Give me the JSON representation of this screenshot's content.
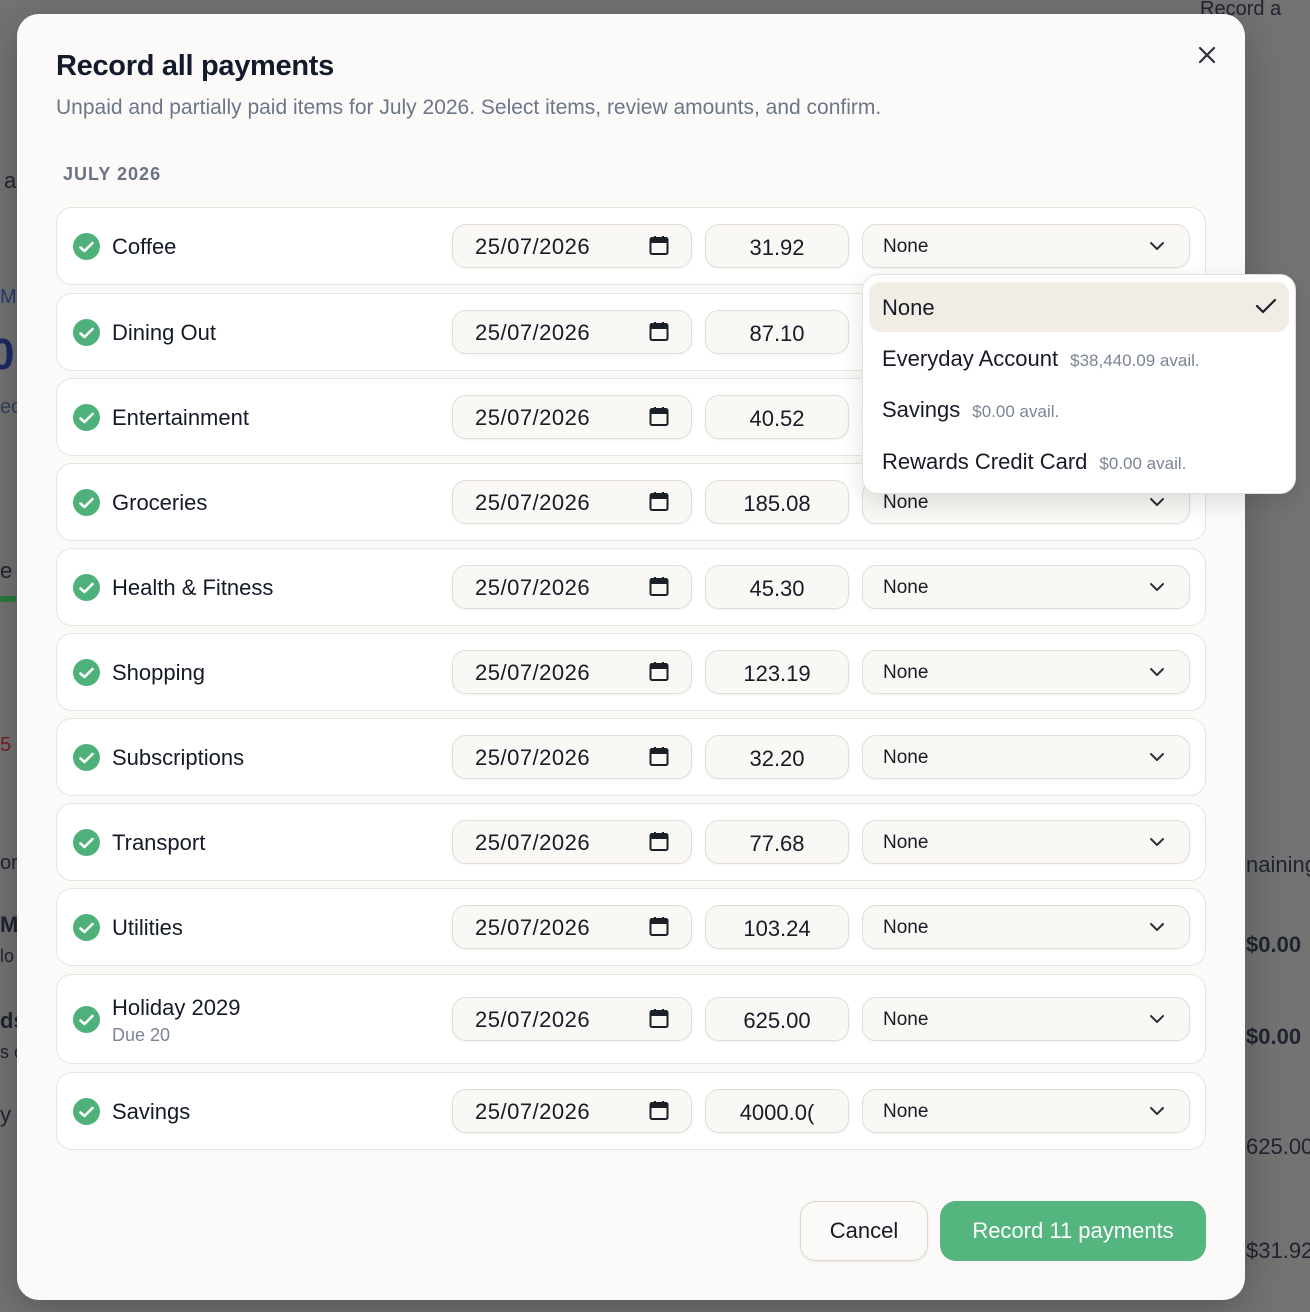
{
  "background": {
    "fragments": [
      "Record a",
      "a",
      "Mc",
      "0",
      "ec",
      "e",
      "5",
      "or",
      "M",
      "lo",
      "ds",
      "s c",
      "y",
      "naining",
      "$0.00",
      "$0.00",
      "625.00",
      "$31.92"
    ]
  },
  "modal": {
    "title": "Record all payments",
    "subtitle": "Unpaid and partially paid items for July 2026. Select items, review amounts, and confirm.",
    "close_icon": "close-icon",
    "section_label": "JULY 2026",
    "rows": [
      {
        "name": "Coffee",
        "sub": "",
        "date": "25/07/2026",
        "amount": "31.92",
        "account": "None"
      },
      {
        "name": "Dining Out",
        "sub": "",
        "date": "25/07/2026",
        "amount": "87.10",
        "account": "None"
      },
      {
        "name": "Entertainment",
        "sub": "",
        "date": "25/07/2026",
        "amount": "40.52",
        "account": "None"
      },
      {
        "name": "Groceries",
        "sub": "",
        "date": "25/07/2026",
        "amount": "185.08",
        "account": "None"
      },
      {
        "name": "Health & Fitness",
        "sub": "",
        "date": "25/07/2026",
        "amount": "45.30",
        "account": "None"
      },
      {
        "name": "Shopping",
        "sub": "",
        "date": "25/07/2026",
        "amount": "123.19",
        "account": "None"
      },
      {
        "name": "Subscriptions",
        "sub": "",
        "date": "25/07/2026",
        "amount": "32.20",
        "account": "None"
      },
      {
        "name": "Transport",
        "sub": "",
        "date": "25/07/2026",
        "amount": "77.68",
        "account": "None"
      },
      {
        "name": "Utilities",
        "sub": "",
        "date": "25/07/2026",
        "amount": "103.24",
        "account": "None"
      },
      {
        "name": "Holiday 2029",
        "sub": "Due 20",
        "date": "25/07/2026",
        "amount": "625.00",
        "account": "None"
      },
      {
        "name": "Savings",
        "sub": "",
        "date": "25/07/2026",
        "amount": "4000.0(",
        "account": "None"
      }
    ],
    "dropdown": {
      "options": [
        {
          "label": "None",
          "avail": "",
          "selected": true
        },
        {
          "label": "Everyday Account",
          "avail": "$38,440.09 avail.",
          "selected": false
        },
        {
          "label": "Savings",
          "avail": "$0.00 avail.",
          "selected": false
        },
        {
          "label": "Rewards Credit Card",
          "avail": "$0.00 avail.",
          "selected": false
        }
      ]
    },
    "cancel_label": "Cancel",
    "record_label": "Record 11 payments"
  },
  "colors": {
    "accent": "#55b57e",
    "check": "#4fb17a",
    "selected_option": "#f1ece4"
  }
}
